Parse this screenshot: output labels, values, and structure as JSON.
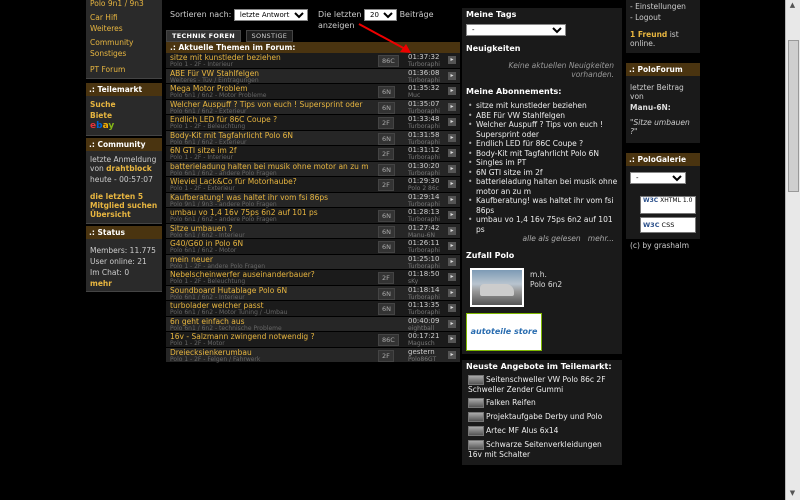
{
  "left": {
    "top_links": [
      "Polo 9n1 / 9n3",
      "Car Hifi",
      "Weiteres",
      "Community",
      "Sonstiges",
      "PT Forum"
    ],
    "teilemarkt_head": "Teilemarkt",
    "teilemarkt_links": [
      "Suche",
      "Biete"
    ],
    "ebay": "ebay",
    "community_head": "Community",
    "community_text1": "letzte Anmeldung von",
    "community_user": "drahtblock",
    "community_time": "heute - 00:57:07",
    "community_line2": "die letzten 5 Mitglied suchen Übersicht",
    "status_head": "Status",
    "status_members": "Members: 11.775",
    "status_online": "User online: 21",
    "status_chat": "Im Chat: 0",
    "status_more": "mehr"
  },
  "toolbar": {
    "sort_label": "Sortieren nach:",
    "sort_value": "letzte Antwort",
    "last_label": "Die letzten",
    "last_value": "20",
    "last_suffix": "Beiträge anzeigen"
  },
  "tabs": [
    "TECHNIK FOREN",
    "SONSTIGE"
  ],
  "list_title": "Aktuelle Themen im Forum:",
  "topics": [
    {
      "title": "sitze mit kunstleder beziehen",
      "sub": "Polo 1 - 2F - Interieur",
      "badge": "86C",
      "time": "01:37:32",
      "user": "Turboraphi"
    },
    {
      "title": "ABE Für VW Stahlfelgen",
      "sub": "Weiteres - Tüv / Eintragungen",
      "badge": "",
      "time": "01:36:08",
      "user": "Turboraphi"
    },
    {
      "title": "Mega Motor Problem",
      "sub": "Polo 6n1 / 6n2 - Motor Probleme",
      "badge": "6N",
      "time": "01:35:32",
      "user": "Muc"
    },
    {
      "title": "Welcher Auspuff ? Tips von euch ! Supersprint oder",
      "sub": "Polo 6n1 / 6n2 - Exterieur",
      "badge": "6N",
      "time": "01:35:07",
      "user": "Turboraphi"
    },
    {
      "title": "Endlich LED für 86C Coupe ?",
      "sub": "Polo 1 - 2F - Beleuchtung",
      "badge": "2F",
      "time": "01:33:48",
      "user": "Turboraphi"
    },
    {
      "title": "Body-Kit mit Tagfahrlicht Polo 6N",
      "sub": "Polo 6n1 / 6n2 - Exterieur",
      "badge": "6N",
      "time": "01:31:58",
      "user": "Turboraphi"
    },
    {
      "title": "6N GTI sitze im 2f",
      "sub": "Polo 1 - 2F - Interieur",
      "badge": "2F",
      "time": "01:31:12",
      "user": "Turboraphi"
    },
    {
      "title": "batterieladung halten bei musik ohne motor an zu m",
      "sub": "Polo 6n1 / 6n2 - andere Polo Fragen",
      "badge": "6N",
      "time": "01:30:20",
      "user": "Turboraphi"
    },
    {
      "title": "Wieviel Lack&Co für Motorhaube?",
      "sub": "Polo 1 - 2F - Exterieur",
      "badge": "2F",
      "time": "01:29:30",
      "user": "Polo 2 86c"
    },
    {
      "title": "Kaufberatung! was haltet ihr vom fsi 86ps",
      "sub": "Polo 9n1 / 9n3 - andere Polo Fragen",
      "badge": "",
      "time": "01:29:14",
      "user": "Turboraphi"
    },
    {
      "title": "umbau vo 1,4 16v 75ps 6n2 auf 101 ps",
      "sub": "Polo 6n1 / 6n2 - andere Polo Fragen",
      "badge": "6N",
      "time": "01:28:13",
      "user": "Turboraphi"
    },
    {
      "title": "Sitze umbauen ?",
      "sub": "Polo 6n1 / 6n2 - Interieur",
      "badge": "6N",
      "time": "01:27:42",
      "user": "Manu-6N"
    },
    {
      "title": "G40/G60 in Polo 6N",
      "sub": "Polo 6n1 / 6n2 - Motor",
      "badge": "6N",
      "time": "01:26:11",
      "user": "Turboraphi"
    },
    {
      "title": "mein neuer",
      "sub": "Polo 1 - 2F - andere Polo Fragen",
      "badge": "",
      "time": "01:25:10",
      "user": "Turboraphi"
    },
    {
      "title": "Nebelscheinwerfer auseinanderbauer?",
      "sub": "Polo 1 - 2F - Beleuchtung",
      "badge": "2F",
      "time": "01:18:50",
      "user": "sKy"
    },
    {
      "title": "Soundboard Hutablage Polo 6N",
      "sub": "Polo 6n1 / 6n2 - Interieur",
      "badge": "6N",
      "time": "01:18:14",
      "user": "Turboraphi"
    },
    {
      "title": "turbolader welcher passt",
      "sub": "Polo 6n1 / 6n2 - Motor Tuning / -Umbau",
      "badge": "6N",
      "time": "01:13:35",
      "user": "Turboraphi"
    },
    {
      "title": "6n geht einfach aus",
      "sub": "Polo 6n1 / 6n2 - technische Probleme",
      "badge": "",
      "time": "00:40:09",
      "user": "eightball"
    },
    {
      "title": "16v - Salzmann zwingend notwendig ?",
      "sub": "Polo 1 - 2F - Motor",
      "badge": "86C",
      "time": "00:17:21",
      "user": "Magusch"
    },
    {
      "title": "Dreiecksienkerumbau",
      "sub": "Polo 1 - 2F - Felgen / Fahrwerk",
      "badge": "2F",
      "time": "gestern",
      "user": "Polo86GT"
    }
  ],
  "rc": {
    "tags_head": "Meine Tags",
    "tags_value": "-",
    "news_head": "Neuigkeiten",
    "news_text": "Keine aktuellen Neuigkeiten vorhanden.",
    "abo_head": "Meine Abonnements:",
    "abos": [
      "sitze mit kunstleder beziehen",
      "ABE Für VW Stahlfelgen",
      "Welcher Auspuff ? Tips von euch ! Supersprint oder",
      "Endlich LED für 86C Coupe ?",
      "Body-Kit mit Tagfahrlicht Polo 6N",
      "Singles im PT",
      "6N GTI sitze im 2f",
      "batterieladung halten bei musik ohne motor an zu m",
      "Kaufberatung! was haltet ihr vom fsi 86ps",
      "umbau vo 1,4 16v 75ps 6n2 auf 101 ps"
    ],
    "abo_all": "alle als gelesen",
    "abo_more": "mehr...",
    "zufall_head": "Zufall Polo",
    "zufall_user": "m.h.",
    "zufall_model": "Polo 6n2",
    "store_text": "autoteile store",
    "offers_head": "Neuste Angebote im Teilemarkt:",
    "offers": [
      "Seitenschweller VW Polo 86c 2F Schweller Zender Gummi",
      "Falken Reifen",
      "Projektaufgabe Derby und Polo",
      "Artec MF Alus 6x14",
      "Schwarze Seitenverkleidungen 16v mit Schalter"
    ]
  },
  "right": {
    "links": [
      "Einstellungen",
      "Logout"
    ],
    "friend_count": "1 Freund",
    "friend_text": "ist online.",
    "poloforum_head": "PoloForum",
    "poloforum_text": "letzter Beitrag von",
    "poloforum_user": "Manu-6N:",
    "poloforum_quote": "\"Sitze umbauen ?\"",
    "galerie_head": "PoloGalerie",
    "galerie_value": "-",
    "w3c1": "XHTML 1.0",
    "w3c2": "CSS",
    "copyright": "(c) by grashalm"
  }
}
